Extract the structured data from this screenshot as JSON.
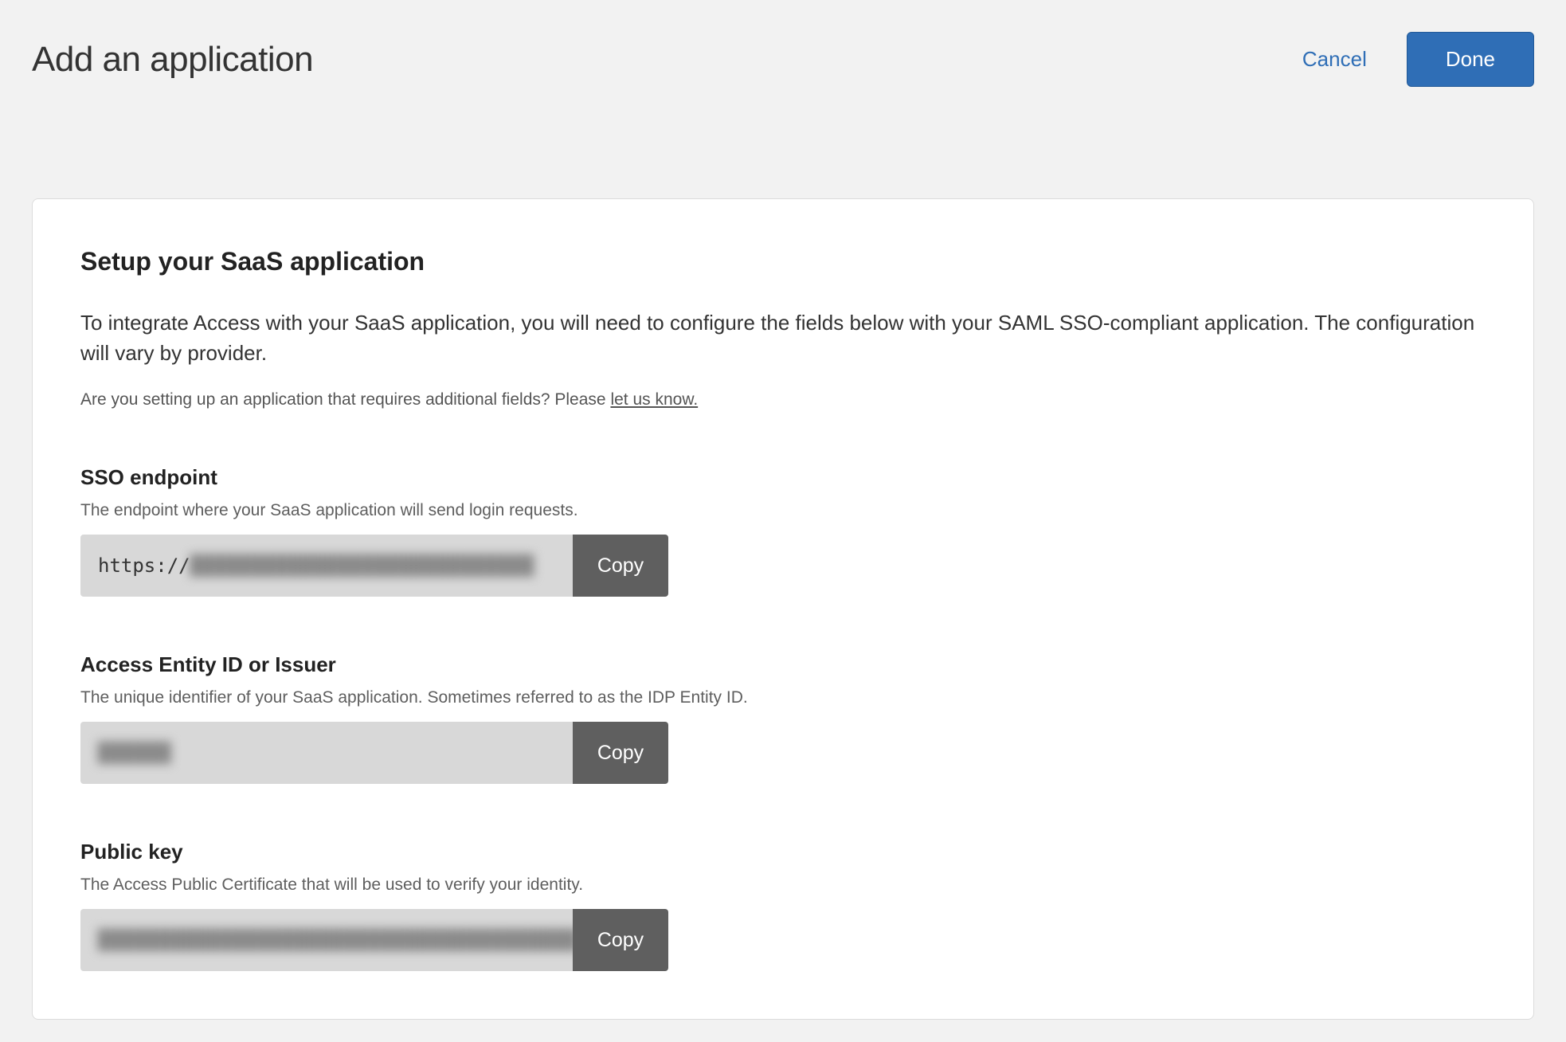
{
  "header": {
    "title": "Add an application",
    "cancel_label": "Cancel",
    "done_label": "Done"
  },
  "card": {
    "title": "Setup your SaaS application",
    "lead": "To integrate Access with your SaaS application, you will need to configure the fields below with your SAML SSO-compliant application. The configuration will vary by provider.",
    "note_prefix": "Are you setting up an application that requires additional fields? Please ",
    "note_link": "let us know.",
    "fields": {
      "sso_endpoint": {
        "label": "SSO endpoint",
        "help": "The endpoint where your SaaS application will send login requests.",
        "value_prefix": "https://",
        "value_obscured": "████████████████████████████",
        "copy_label": "Copy"
      },
      "entity_id": {
        "label": "Access Entity ID or Issuer",
        "help": "The unique identifier of your SaaS application. Sometimes referred to as the IDP Entity ID.",
        "value_obscured": "██████",
        "copy_label": "Copy"
      },
      "public_key": {
        "label": "Public key",
        "help": "The Access Public Certificate that will be used to verify your identity.",
        "value_obscured": "███████████████████████████████████████",
        "copy_label": "Copy"
      }
    }
  }
}
